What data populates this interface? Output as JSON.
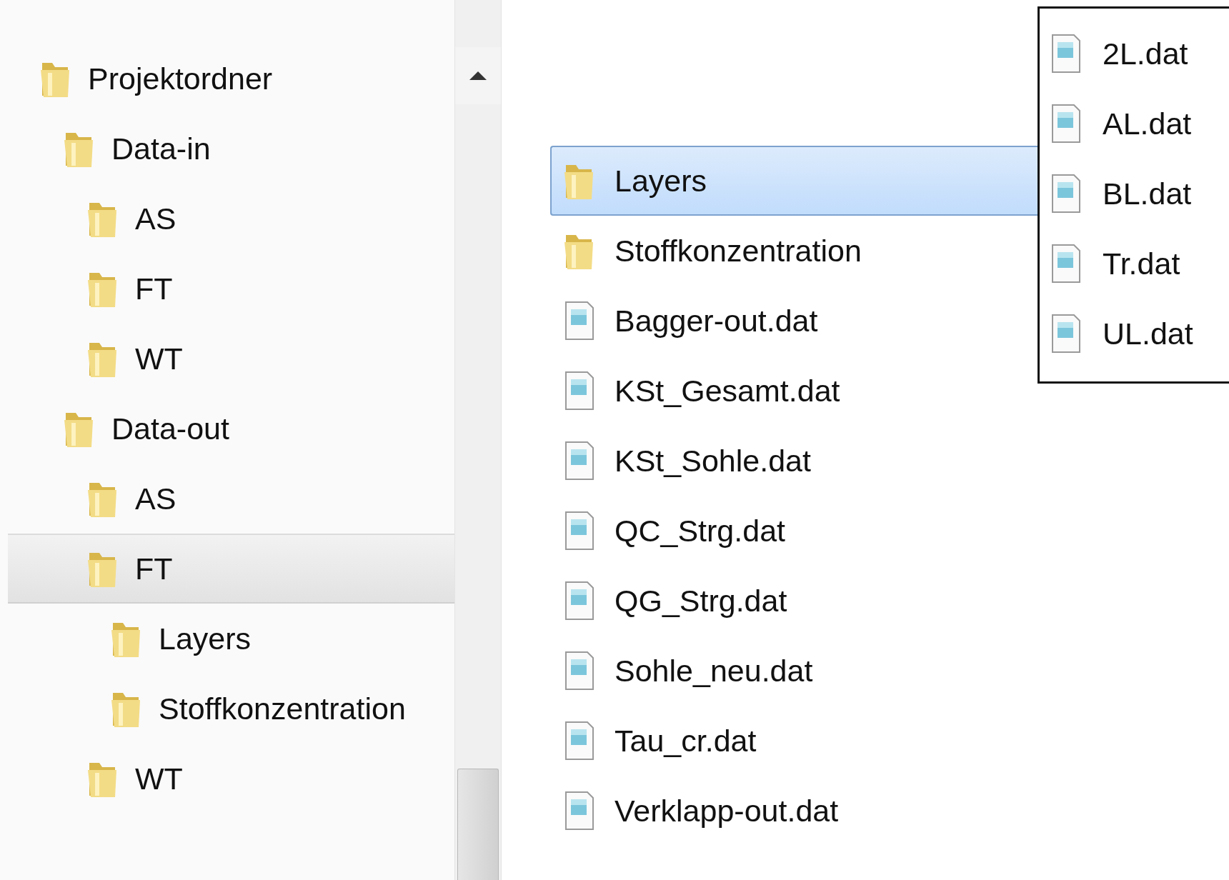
{
  "tree": [
    {
      "label": "Projektordner",
      "selected": false,
      "children": [
        {
          "label": "Data-in",
          "selected": false,
          "children": [
            {
              "label": "AS",
              "selected": false
            },
            {
              "label": "FT",
              "selected": false
            },
            {
              "label": "WT",
              "selected": false
            }
          ]
        },
        {
          "label": "Data-out",
          "selected": false,
          "children": [
            {
              "label": "AS",
              "selected": false
            },
            {
              "label": "FT",
              "selected": true,
              "children": [
                {
                  "label": "Layers",
                  "selected": false
                },
                {
                  "label": "Stoffkonzentration",
                  "selected": false
                }
              ]
            },
            {
              "label": "WT",
              "selected": false
            }
          ]
        }
      ]
    }
  ],
  "files": [
    {
      "kind": "folder",
      "name": "Layers",
      "selected": true
    },
    {
      "kind": "folder",
      "name": "Stoffkonzentration",
      "selected": false
    },
    {
      "kind": "file",
      "name": "Bagger-out.dat",
      "selected": false
    },
    {
      "kind": "file",
      "name": "KSt_Gesamt.dat",
      "selected": false
    },
    {
      "kind": "file",
      "name": "KSt_Sohle.dat",
      "selected": false
    },
    {
      "kind": "file",
      "name": "QC_Strg.dat",
      "selected": false
    },
    {
      "kind": "file",
      "name": "QG_Strg.dat",
      "selected": false
    },
    {
      "kind": "file",
      "name": "Sohle_neu.dat",
      "selected": false
    },
    {
      "kind": "file",
      "name": "Tau_cr.dat",
      "selected": false
    },
    {
      "kind": "file",
      "name": "Verklapp-out.dat",
      "selected": false
    }
  ],
  "popup": {
    "files": [
      {
        "kind": "file",
        "name": "2L.dat"
      },
      {
        "kind": "file",
        "name": "AL.dat"
      },
      {
        "kind": "file",
        "name": "BL.dat"
      },
      {
        "kind": "file",
        "name": "Tr.dat"
      },
      {
        "kind": "file",
        "name": "UL.dat"
      }
    ]
  }
}
